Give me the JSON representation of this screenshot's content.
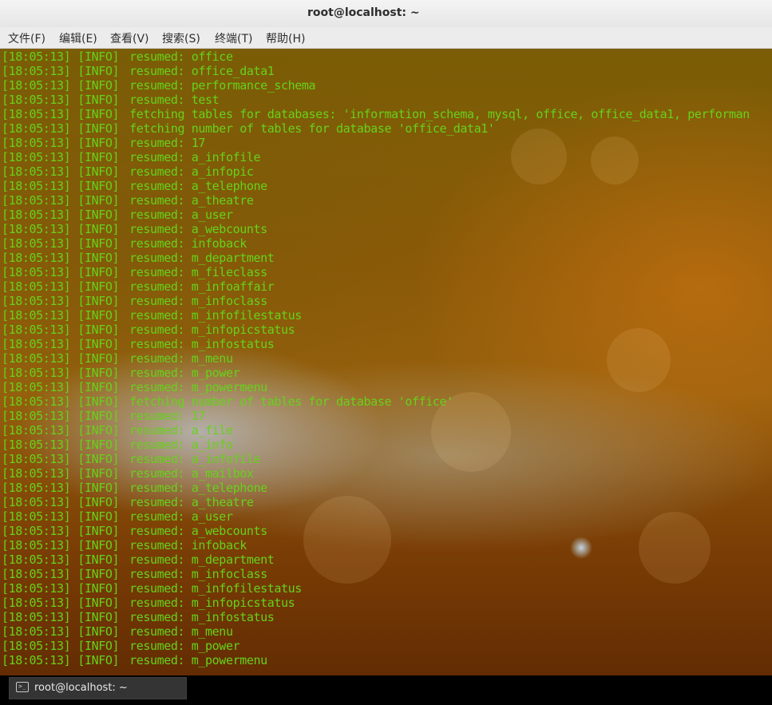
{
  "window": {
    "title": "root@localhost: ~"
  },
  "menu": [
    {
      "label": "文件(F)"
    },
    {
      "label": "编辑(E)"
    },
    {
      "label": "查看(V)"
    },
    {
      "label": "搜索(S)"
    },
    {
      "label": "终端(T)"
    },
    {
      "label": "帮助(H)"
    }
  ],
  "terminal": {
    "colors": {
      "text": "#66d21a"
    },
    "lines": [
      {
        "time": "[18:05:13]",
        "level": "[INFO]",
        "msg": "resumed: office"
      },
      {
        "time": "[18:05:13]",
        "level": "[INFO]",
        "msg": "resumed: office_data1"
      },
      {
        "time": "[18:05:13]",
        "level": "[INFO]",
        "msg": "resumed: performance_schema"
      },
      {
        "time": "[18:05:13]",
        "level": "[INFO]",
        "msg": "resumed: test"
      },
      {
        "time": "[18:05:13]",
        "level": "[INFO]",
        "msg": "fetching tables for databases: 'information_schema, mysql, office, office_data1, performan"
      },
      {
        "time": "[18:05:13]",
        "level": "[INFO]",
        "msg": "fetching number of tables for database 'office_data1'"
      },
      {
        "time": "[18:05:13]",
        "level": "[INFO]",
        "msg": "resumed: 17"
      },
      {
        "time": "[18:05:13]",
        "level": "[INFO]",
        "msg": "resumed: a_infofile"
      },
      {
        "time": "[18:05:13]",
        "level": "[INFO]",
        "msg": "resumed: a_infopic"
      },
      {
        "time": "[18:05:13]",
        "level": "[INFO]",
        "msg": "resumed: a_telephone"
      },
      {
        "time": "[18:05:13]",
        "level": "[INFO]",
        "msg": "resumed: a_theatre"
      },
      {
        "time": "[18:05:13]",
        "level": "[INFO]",
        "msg": "resumed: a_user"
      },
      {
        "time": "[18:05:13]",
        "level": "[INFO]",
        "msg": "resumed: a_webcounts"
      },
      {
        "time": "[18:05:13]",
        "level": "[INFO]",
        "msg": "resumed: infoback"
      },
      {
        "time": "[18:05:13]",
        "level": "[INFO]",
        "msg": "resumed: m_department"
      },
      {
        "time": "[18:05:13]",
        "level": "[INFO]",
        "msg": "resumed: m_fileclass"
      },
      {
        "time": "[18:05:13]",
        "level": "[INFO]",
        "msg": "resumed: m_infoaffair"
      },
      {
        "time": "[18:05:13]",
        "level": "[INFO]",
        "msg": "resumed: m_infoclass"
      },
      {
        "time": "[18:05:13]",
        "level": "[INFO]",
        "msg": "resumed: m_infofilestatus"
      },
      {
        "time": "[18:05:13]",
        "level": "[INFO]",
        "msg": "resumed: m_infopicstatus"
      },
      {
        "time": "[18:05:13]",
        "level": "[INFO]",
        "msg": "resumed: m_infostatus"
      },
      {
        "time": "[18:05:13]",
        "level": "[INFO]",
        "msg": "resumed: m_menu"
      },
      {
        "time": "[18:05:13]",
        "level": "[INFO]",
        "msg": "resumed: m_power"
      },
      {
        "time": "[18:05:13]",
        "level": "[INFO]",
        "msg": "resumed: m_powermenu"
      },
      {
        "time": "[18:05:13]",
        "level": "[INFO]",
        "msg": "fetching number of tables for database 'office'"
      },
      {
        "time": "[18:05:13]",
        "level": "[INFO]",
        "msg": "resumed: 17"
      },
      {
        "time": "[18:05:13]",
        "level": "[INFO]",
        "msg": "resumed: a_file"
      },
      {
        "time": "[18:05:13]",
        "level": "[INFO]",
        "msg": "resumed: a_info"
      },
      {
        "time": "[18:05:13]",
        "level": "[INFO]",
        "msg": "resumed: a_infofile"
      },
      {
        "time": "[18:05:13]",
        "level": "[INFO]",
        "msg": "resumed: a_mailbox"
      },
      {
        "time": "[18:05:13]",
        "level": "[INFO]",
        "msg": "resumed: a_telephone"
      },
      {
        "time": "[18:05:13]",
        "level": "[INFO]",
        "msg": "resumed: a_theatre"
      },
      {
        "time": "[18:05:13]",
        "level": "[INFO]",
        "msg": "resumed: a_user"
      },
      {
        "time": "[18:05:13]",
        "level": "[INFO]",
        "msg": "resumed: a_webcounts"
      },
      {
        "time": "[18:05:13]",
        "level": "[INFO]",
        "msg": "resumed: infoback"
      },
      {
        "time": "[18:05:13]",
        "level": "[INFO]",
        "msg": "resumed: m_department"
      },
      {
        "time": "[18:05:13]",
        "level": "[INFO]",
        "msg": "resumed: m_infoclass"
      },
      {
        "time": "[18:05:13]",
        "level": "[INFO]",
        "msg": "resumed: m_infofilestatus"
      },
      {
        "time": "[18:05:13]",
        "level": "[INFO]",
        "msg": "resumed: m_infopicstatus"
      },
      {
        "time": "[18:05:13]",
        "level": "[INFO]",
        "msg": "resumed: m_infostatus"
      },
      {
        "time": "[18:05:13]",
        "level": "[INFO]",
        "msg": "resumed: m_menu"
      },
      {
        "time": "[18:05:13]",
        "level": "[INFO]",
        "msg": "resumed: m_power"
      },
      {
        "time": "[18:05:13]",
        "level": "[INFO]",
        "msg": "resumed: m_powermenu"
      }
    ]
  },
  "taskbar": {
    "items": [
      {
        "label": "root@localhost: ~",
        "icon": "terminal-icon"
      }
    ]
  }
}
